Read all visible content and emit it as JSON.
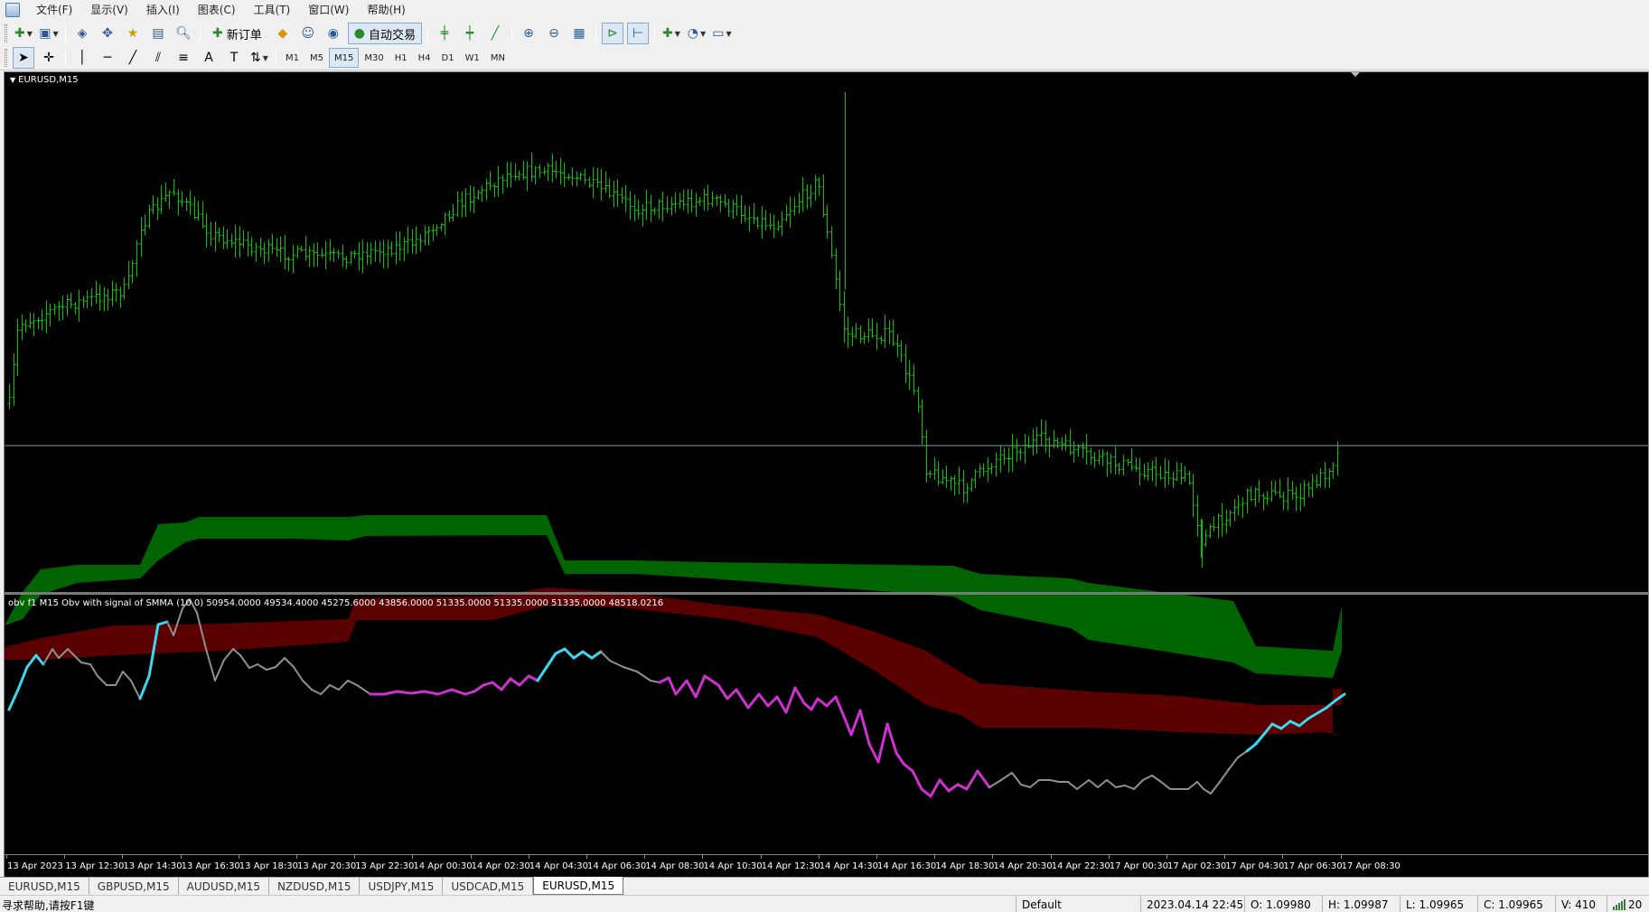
{
  "menu": [
    "文件(F)",
    "显示(V)",
    "插入(I)",
    "图表(C)",
    "工具(T)",
    "窗口(W)",
    "帮助(H)"
  ],
  "toolbar": {
    "new_order_label": "新订单",
    "auto_trade_label": "自动交易"
  },
  "timeframes": [
    "M1",
    "M5",
    "M15",
    "M30",
    "H1",
    "H4",
    "D1",
    "W1",
    "MN"
  ],
  "active_timeframe": "M15",
  "chart": {
    "symbol_label": "EURUSD,M15",
    "indicator_label": "obv f1 M15 Obv with signal of SMMA (10 0) 50954.0000 49534.4000 45275.6000 43856.0000 51335.0000 51335.0000 51335.0000 48518.0216",
    "time_labels": [
      "13 Apr 2023",
      "13 Apr 12:30",
      "13 Apr 14:30",
      "13 Apr 16:30",
      "13 Apr 18:30",
      "13 Apr 20:30",
      "13 Apr 22:30",
      "14 Apr 00:30",
      "14 Apr 02:30",
      "14 Apr 04:30",
      "14 Apr 06:30",
      "14 Apr 08:30",
      "14 Apr 10:30",
      "14 Apr 12:30",
      "14 Apr 14:30",
      "14 Apr 16:30",
      "14 Apr 18:30",
      "14 Apr 20:30",
      "14 Apr 22:30",
      "17 Apr 00:30",
      "17 Apr 02:30",
      "17 Apr 04:30",
      "17 Apr 06:30",
      "17 Apr 08:30"
    ],
    "colors": {
      "background": "#000000",
      "bars": "#00c800",
      "ask_line": "#8a9aa8",
      "obv_line_neutral": "#909090",
      "obv_line_up": "#3cd8f0",
      "obv_line_down": "#d030d0",
      "band_green": "#006400",
      "band_red": "#5a0000"
    }
  },
  "tabs": [
    "EURUSD,M15",
    "GBPUSD,M15",
    "AUDUSD,M15",
    "NZDUSD,M15",
    "USDJPY,M15",
    "USDCAD,M15",
    "EURUSD,M15"
  ],
  "active_tab_index": 6,
  "status": {
    "help": "寻求帮助,请按F1键",
    "profile": "Default",
    "datetime": "2023.04.14 22:45",
    "open": "O: 1.09980",
    "high": "H: 1.09987",
    "low": "L: 1.09965",
    "close": "C: 1.09965",
    "volume": "V: 410",
    "connection": "20"
  }
}
